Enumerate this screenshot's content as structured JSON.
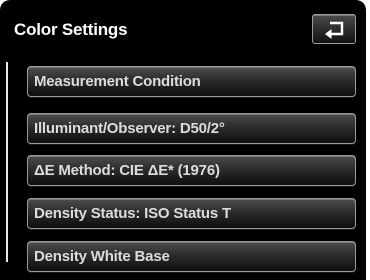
{
  "header": {
    "title": "Color Settings",
    "back_icon": "back-arrow-icon"
  },
  "menu": {
    "items": [
      {
        "label": "Measurement Condition"
      },
      {
        "label": "Illuminant/Observer: D50/2°"
      },
      {
        "label": "ΔE Method: CIE ΔE* (1976)"
      },
      {
        "label": "Density Status: ISO Status T"
      },
      {
        "label": "Density White Base"
      }
    ]
  },
  "colors": {
    "background": "#000000",
    "text": "#ffffff",
    "button_border": "#9a9a9a"
  }
}
